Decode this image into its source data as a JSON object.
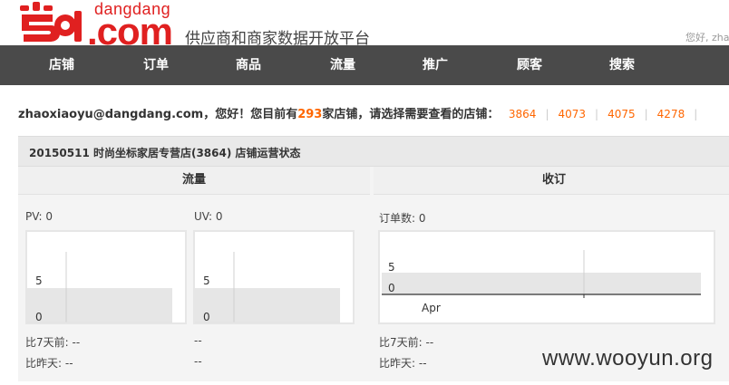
{
  "header": {
    "logo_small": "dangdang",
    "logo_big": ".com",
    "platform_title": "供应商和商家数据开放平台",
    "greeting": "您好, zha"
  },
  "nav": {
    "items": [
      {
        "label": "店铺"
      },
      {
        "label": "订单"
      },
      {
        "label": "商品"
      },
      {
        "label": "流量"
      },
      {
        "label": "推广"
      },
      {
        "label": "顾客"
      },
      {
        "label": "搜索"
      }
    ]
  },
  "shopline": {
    "prefix": "zhaoxiaoyu@dangdang.com，您好！您目前有",
    "count": "293",
    "suffix": "家店铺，请选择需要查看的店铺：",
    "shops": [
      "3864",
      "4073",
      "4075",
      "4278"
    ]
  },
  "panel": {
    "title": "20150511 时尚坐标家居专营店(3864) 店铺运营状态",
    "traffic_label": "流量",
    "orders_label": "收订",
    "pv_label": "PV: 0",
    "uv_label": "UV: 0",
    "order_count_label": "订单数: 0",
    "pv_week": "比7天前: --",
    "pv_day": "比昨天: --",
    "uv_week": "--",
    "uv_day": "--",
    "ord_week": "比7天前: --",
    "ord_day": "比昨天: --"
  },
  "chart_data": [
    {
      "type": "area",
      "name": "pv",
      "y_ticks": [
        "5",
        "0"
      ],
      "ylim": [
        0,
        10
      ],
      "values": [
        0
      ]
    },
    {
      "type": "area",
      "name": "uv",
      "y_ticks": [
        "5",
        "0"
      ],
      "ylim": [
        0,
        10
      ],
      "values": [
        0
      ]
    },
    {
      "type": "line",
      "name": "orders",
      "y_ticks": [
        "5",
        "0"
      ],
      "x_ticks": [
        "Apr"
      ],
      "ylim": [
        0,
        5
      ],
      "values": [
        0
      ]
    }
  ],
  "watermark": "www.wooyun.org",
  "colors": {
    "brand": "#e02020",
    "accent": "#ff6600",
    "nav_bg": "#4a4a4a"
  }
}
